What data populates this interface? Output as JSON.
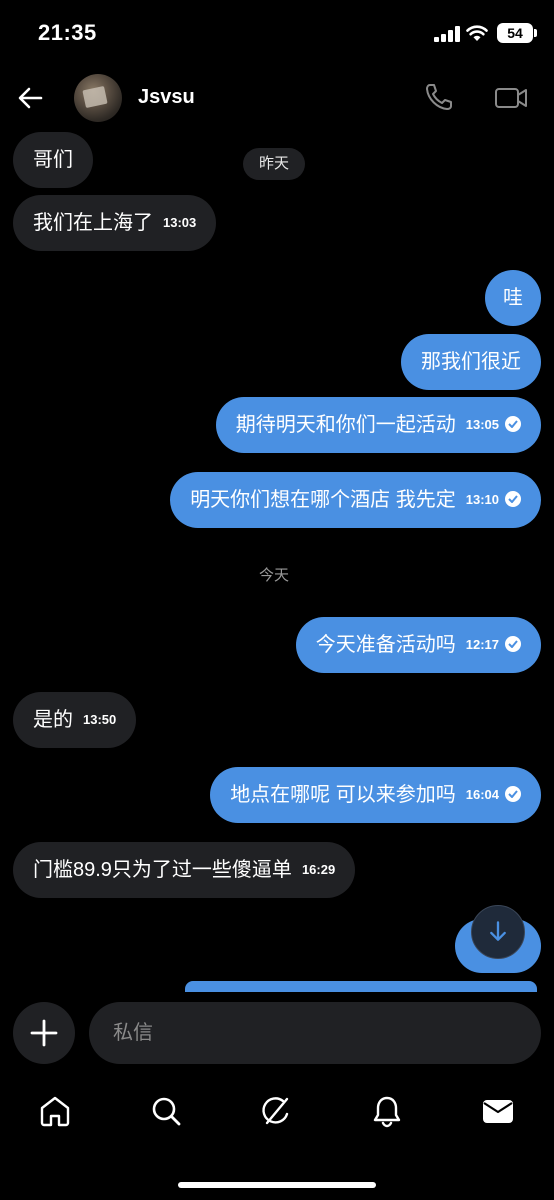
{
  "status_bar": {
    "time": "21:35",
    "battery": "54"
  },
  "header": {
    "contact_name": "Jsvsu"
  },
  "dates": {
    "yesterday": "昨天",
    "today": "今天"
  },
  "messages": [
    {
      "direction": "in",
      "text": "哥们",
      "time": ""
    },
    {
      "direction": "in",
      "text": "我们在上海了",
      "time": "13:03"
    },
    {
      "direction": "out",
      "text": "哇",
      "time": ""
    },
    {
      "direction": "out",
      "text": "那我们很近",
      "time": ""
    },
    {
      "direction": "out",
      "text": "期待明天和你们一起活动",
      "time": "13:05"
    },
    {
      "direction": "out",
      "text": "明天你们想在哪个酒店 我先定",
      "time": "13:10"
    },
    {
      "direction": "out",
      "text": "今天准备活动吗",
      "time": "12:17"
    },
    {
      "direction": "in",
      "text": "是的",
      "time": "13:50"
    },
    {
      "direction": "out",
      "text": "地点在哪呢 可以来参加吗",
      "time": "16:04"
    },
    {
      "direction": "in",
      "text": "门槛89.9只为了过一些傻逼单",
      "time": "16:29"
    }
  ],
  "composer": {
    "placeholder": "私信"
  },
  "colors": {
    "outgoing_bubble": "#4a90e2",
    "incoming_bubble": "#202124",
    "background": "#000000"
  },
  "icons": {
    "header": [
      "back-arrow-icon",
      "phone-icon",
      "video-icon"
    ],
    "nav": [
      "home-icon",
      "search-icon",
      "grok-icon",
      "bell-icon",
      "mail-icon"
    ]
  }
}
